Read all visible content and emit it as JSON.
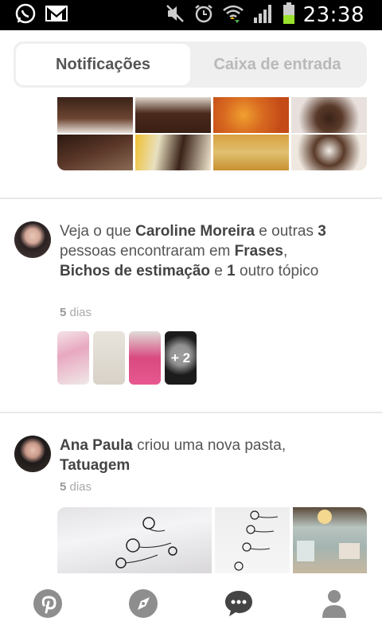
{
  "status_bar": {
    "time": "23:38",
    "left_icons": [
      "whatsapp-icon",
      "gmail-icon"
    ],
    "right_icons": [
      "mute-icon",
      "alarm-icon",
      "wifi-icon",
      "signal-icon",
      "battery-icon"
    ]
  },
  "tabs": [
    {
      "label": "Notificações",
      "active": true
    },
    {
      "label": "Caixa de entrada",
      "active": false
    }
  ],
  "notifications": [
    {
      "parts": [
        {
          "text": "Veja o que ",
          "bold": false
        },
        {
          "text": "Caroline Moreira",
          "bold": true
        },
        {
          "text": " e outras ",
          "bold": false
        },
        {
          "text": "3",
          "bold": true
        },
        {
          "text": " pessoas encontraram em ",
          "bold": false
        },
        {
          "text": "Frases",
          "bold": true
        },
        {
          "text": ", ",
          "bold": false
        },
        {
          "text": "Bichos de estimação",
          "bold": true
        },
        {
          "text": " e ",
          "bold": false
        },
        {
          "text": "1",
          "bold": true
        },
        {
          "text": " outro tópico",
          "bold": false
        }
      ],
      "time_number": "5",
      "time_unit": " dias",
      "more_count": "+ 2"
    },
    {
      "parts": [
        {
          "text": "Ana Paula",
          "bold": true
        },
        {
          "text": " criou uma nova pasta, ",
          "bold": false
        },
        {
          "text": "Tatuagem",
          "bold": true
        }
      ],
      "time_number": "5",
      "time_unit": " dias"
    }
  ],
  "bottom_nav": [
    "pinterest-icon",
    "explore-compass-icon",
    "notifications-chat-icon",
    "profile-icon"
  ],
  "colors": {
    "tab_bg": "#efefef",
    "tab_active_bg": "#ffffff",
    "text": "#555555",
    "muted": "#aaaaaa",
    "nav_icon": "#8e8e8e"
  }
}
